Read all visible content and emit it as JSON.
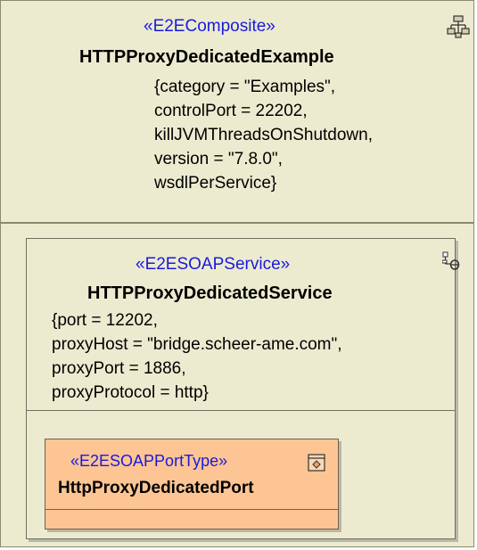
{
  "composite": {
    "stereotype": "«E2EComposite»",
    "name": "HTTPProxyDedicatedExample",
    "properties": [
      "{category = \"Examples\",",
      "controlPort = 22202,",
      "killJVMThreadsOnShutdown,",
      "version = \"7.8.0\",",
      "wsdlPerService}"
    ],
    "icon": "composite-structure-icon"
  },
  "service": {
    "stereotype": "«E2ESOAPService»",
    "name": "HTTPProxyDedicatedService",
    "properties": [
      "{port = 12202,",
      "proxyHost = \"bridge.scheer-ame.com\",",
      "proxyPort = 1886,",
      "proxyProtocol = http}"
    ],
    "icon": "service-component-icon"
  },
  "port": {
    "stereotype": "«E2ESOAPPortType»",
    "name": "HttpProxyDedicatedPort",
    "icon": "port-type-icon"
  },
  "colors": {
    "element_fill": "#ecebd0",
    "port_fill": "#fdc593",
    "stereotype_text": "#1a1adc"
  }
}
